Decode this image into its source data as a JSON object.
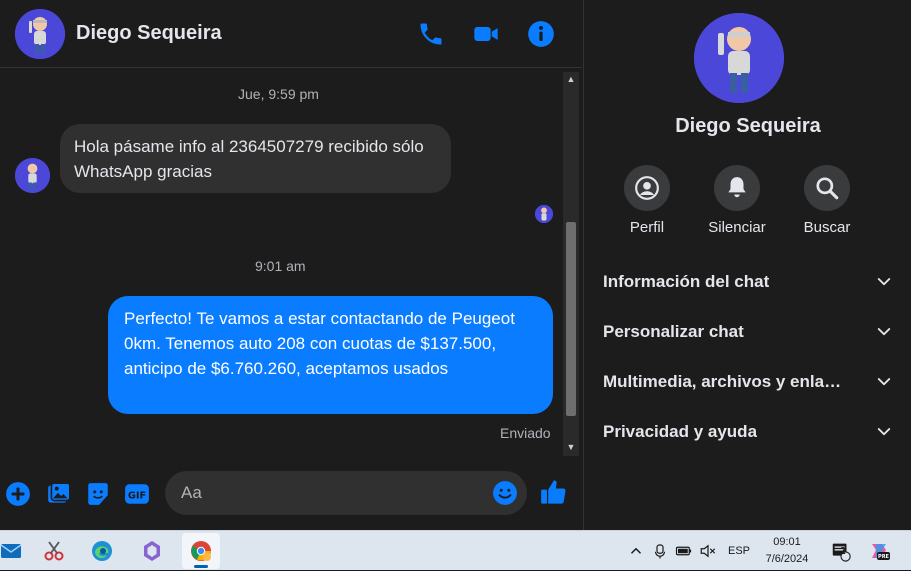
{
  "header": {
    "contact_name": "Diego Sequeira",
    "icons": [
      "phone-icon",
      "video-icon",
      "info-icon"
    ]
  },
  "messages": {
    "timestamp_1": "Jue, 9:59 pm",
    "incoming_text": "Hola pásame info al 2364507279 recibido sólo WhatsApp gracias",
    "timestamp_2": "9:01 am",
    "outgoing_text": "Perfecto! Te vamos a estar contactando de Peugeot 0km. Tenemos auto 208 con cuotas de $137.500, anticipo de $6.760.260, aceptamos usados",
    "status": "Enviado"
  },
  "composer": {
    "placeholder": "Aa"
  },
  "panel": {
    "contact_name": "Diego Sequeira",
    "actions": [
      {
        "label": "Perfil",
        "icon": "profile-icon"
      },
      {
        "label": "Silenciar",
        "icon": "bell-icon"
      },
      {
        "label": "Buscar",
        "icon": "search-icon"
      }
    ],
    "sections": [
      {
        "label": "Información del chat"
      },
      {
        "label": "Personalizar chat"
      },
      {
        "label": "Multimedia, archivos y enlaces"
      },
      {
        "label": "Privacidad y ayuda"
      }
    ]
  },
  "taskbar": {
    "language": "ESP",
    "time": "09:01",
    "date": "7/6/2024",
    "notification_count": "2"
  },
  "colors": {
    "accent": "#0a7cff",
    "background": "#1c1c1d",
    "bubble_incoming": "#303030",
    "icon_blue": "#0a7cff"
  }
}
